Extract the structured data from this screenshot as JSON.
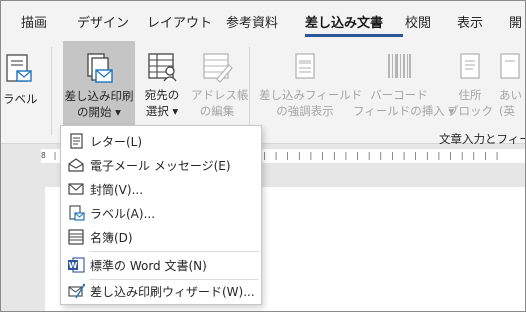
{
  "tabs": [
    {
      "label": "描画"
    },
    {
      "label": "デザイン"
    },
    {
      "label": "レイアウト"
    },
    {
      "label": "参考資料"
    },
    {
      "label": "差し込み文書"
    },
    {
      "label": "校閲"
    },
    {
      "label": "表示"
    },
    {
      "label": "開"
    }
  ],
  "ribbon": {
    "label_button": "ラベル",
    "start_merge": {
      "line1": "差し込み印刷",
      "line2": "の開始 ▾"
    },
    "select_recipients": {
      "line1": "宛先の",
      "line2": "選択 ▾"
    },
    "edit_address": {
      "line1": "アドレス帳",
      "line2": "の編集"
    },
    "highlight_fields": {
      "line1": "差し込みフィールド",
      "line2": "の強調表示"
    },
    "barcode": {
      "line1": "バーコード",
      "line2": "フィールドの挿入 ▾"
    },
    "address_block": {
      "line1": "住所",
      "line2": "ブロック"
    },
    "greeting": {
      "line1": "あい",
      "line2": "(英"
    },
    "group_label": "文章入力とフィー"
  },
  "ruler_text": "8 | 1 | | | | | | | | | | | | | | | | | | | | | | | | | | | | | | | | | | | | |",
  "menu": {
    "items": [
      {
        "label": "レター(L)",
        "icon": "letter-icon"
      },
      {
        "label": "電子メール メッセージ(E)",
        "icon": "envelope-open-icon"
      },
      {
        "label": "封筒(V)...",
        "icon": "envelope-icon"
      },
      {
        "label": "ラベル(A)...",
        "icon": "label-icon"
      },
      {
        "label": "名簿(D)",
        "icon": "directory-icon"
      },
      {
        "label": "標準の Word 文書(N)",
        "icon": "word-doc-icon"
      },
      {
        "label": "差し込み印刷ウィザード(W)...",
        "icon": "wizard-icon"
      }
    ]
  },
  "colors": {
    "accent": "#2b579a",
    "disabled": "#a6a6a6",
    "word_blue": "#2b579a",
    "icon_blue": "#1e73be"
  }
}
